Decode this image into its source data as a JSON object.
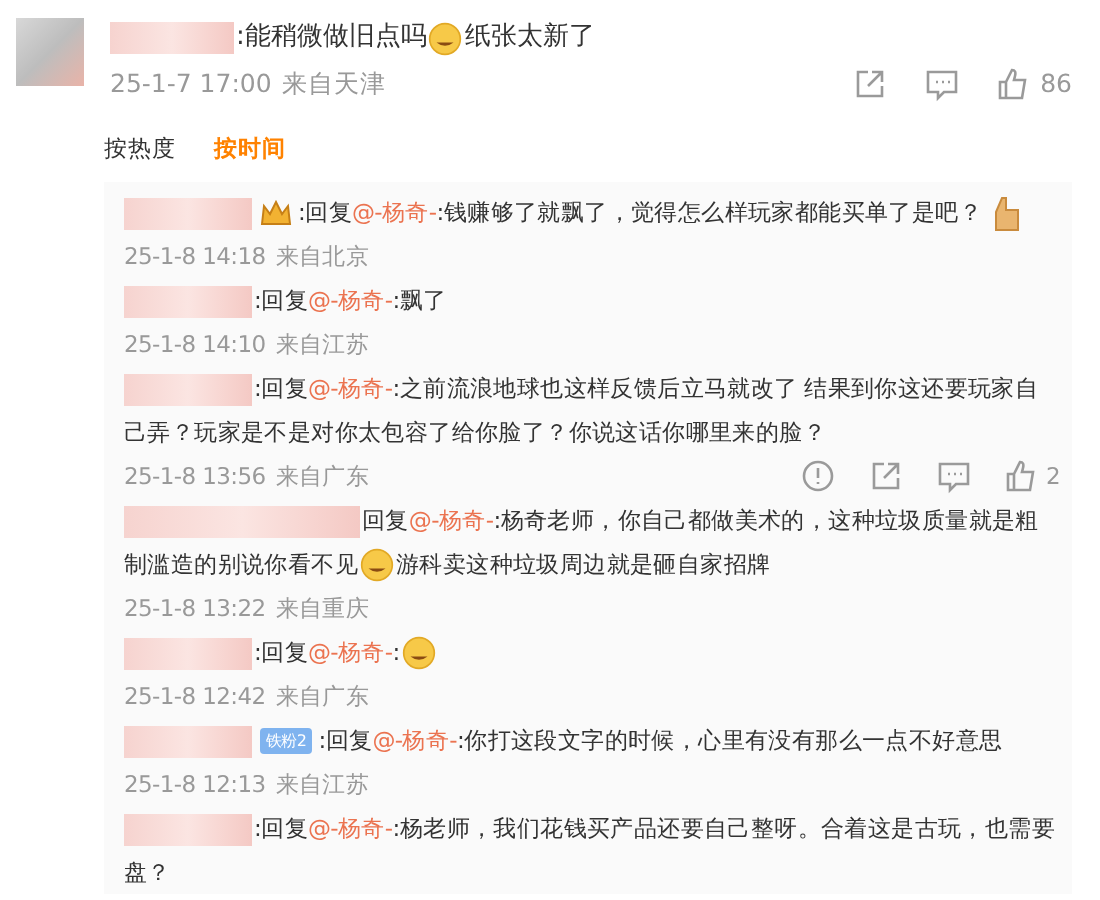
{
  "comment": {
    "parts": [
      {
        "kind": "text",
        "text": ":能稍微做旧点吗"
      },
      {
        "kind": "emoji"
      },
      {
        "kind": "text",
        "text": "纸张太新了"
      }
    ],
    "date": "25-1-7 17:00",
    "location": "来自天津",
    "likes": "86"
  },
  "sort_tabs": [
    {
      "label": "按热度",
      "selected": false
    },
    {
      "label": "按时间",
      "selected": true
    }
  ],
  "replies": [
    {
      "badge_icon": true,
      "prefix": ":回复",
      "mention": "@-杨奇-",
      "parts": [
        {
          "kind": "text",
          "text": ":钱赚够了就飘了，觉得怎么样玩家都能买单了是吧？"
        },
        {
          "kind": "thumb"
        }
      ],
      "date": "25-1-8 14:18",
      "location": "来自北京",
      "hovered": false
    },
    {
      "prefix": ":回复",
      "mention": "@-杨奇-",
      "parts": [
        {
          "kind": "text",
          "text": ":飘了"
        }
      ],
      "date": "25-1-8 14:10",
      "location": "来自江苏",
      "hovered": false
    },
    {
      "prefix": ":回复",
      "mention": "@-杨奇-",
      "parts": [
        {
          "kind": "text",
          "text": ":之前流浪地球也这样反馈后立马就改了 结果到你这还要玩家自己弄？玩家是不是对你太包容了给你脸了？你说这话你哪里来的脸？"
        }
      ],
      "date": "25-1-8 13:56",
      "location": "来自广东",
      "hovered": true,
      "likes": "2"
    },
    {
      "prefix": "回复",
      "mention": "@-杨奇-",
      "parts": [
        {
          "kind": "text",
          "text": ":杨奇老师，你自己都做美术的，这种垃圾质量就是粗制滥造的别说你看不见"
        },
        {
          "kind": "emoji"
        },
        {
          "kind": "text",
          "text": "游科卖这种垃圾周边就是砸自家招牌"
        }
      ],
      "date": "25-1-8 13:22",
      "location": "来自重庆",
      "hovered": false
    },
    {
      "prefix": ":回复",
      "mention": "@-杨奇-",
      "parts": [
        {
          "kind": "text",
          "text": ":"
        },
        {
          "kind": "emoji"
        }
      ],
      "date": "25-1-8 12:42",
      "location": "来自广东",
      "hovered": false
    },
    {
      "fan_badge": "铁粉2",
      "prefix": ":回复",
      "mention": "@-杨奇-",
      "parts": [
        {
          "kind": "text",
          "text": ":你打这段文字的时候，心里有没有那么一点不好意思"
        }
      ],
      "date": "25-1-8 12:13",
      "location": "来自江苏",
      "hovered": false
    },
    {
      "prefix": ":回复",
      "mention": "@-杨奇-",
      "parts": [
        {
          "kind": "text",
          "text": ":杨老师，我们花钱买产品还要自己整呀。合着这是古玩，也需要盘？"
        }
      ]
    }
  ]
}
